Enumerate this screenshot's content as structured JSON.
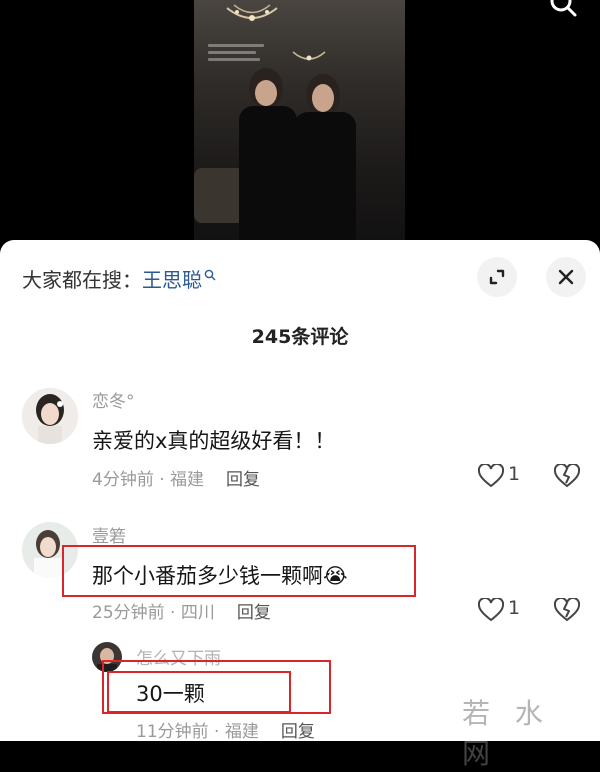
{
  "hot_search": {
    "prefix": "大家都在搜：",
    "keyword": "王思聪"
  },
  "comments_header": {
    "count_label": "245条评论"
  },
  "comments": [
    {
      "author": "恋冬°",
      "text": "亲爱的x真的超级好看！！",
      "meta": "4分钟前 · 福建",
      "reply": "回复",
      "likes": "1"
    },
    {
      "author": "壹箬",
      "text": "那个小番茄多少钱一颗啊",
      "emoji": "😭",
      "meta": "25分钟前 · 四川",
      "reply": "回复",
      "likes": "1"
    }
  ],
  "reply": {
    "author": "怎么又下雨",
    "text": "30一颗",
    "meta": "11分钟前 · 福建",
    "reply": "回复"
  },
  "watermark": "若 水 网",
  "colors": {
    "highlight_box": "#d8262b",
    "keyword": "#2b5a93"
  }
}
